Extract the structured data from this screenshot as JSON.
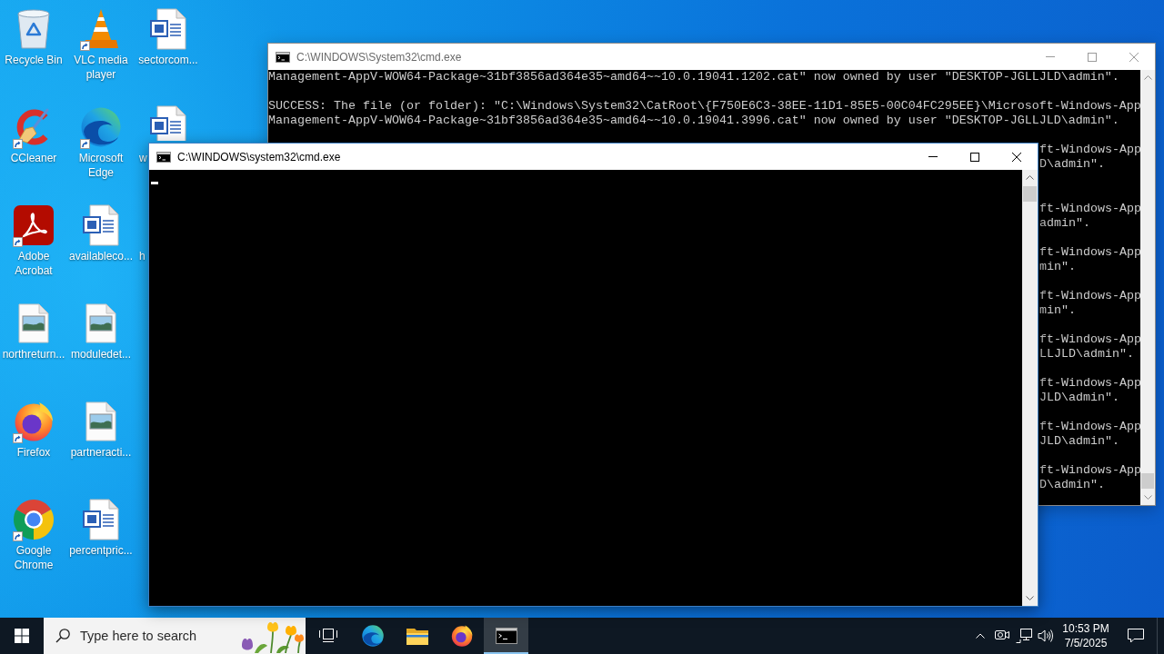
{
  "desktop_icons": [
    {
      "label": "Recycle Bin",
      "kind": "recycle-bin",
      "shortcut": false
    },
    {
      "label": "CCleaner",
      "kind": "ccleaner",
      "shortcut": true
    },
    {
      "label": "Adobe Acrobat",
      "kind": "acrobat",
      "shortcut": true
    },
    {
      "label": "northreturn...",
      "kind": "image-file",
      "shortcut": false
    },
    {
      "label": "Firefox",
      "kind": "firefox",
      "shortcut": true
    },
    {
      "label": "Google Chrome",
      "kind": "chrome",
      "shortcut": true
    },
    {
      "label": "VLC media player",
      "kind": "vlc",
      "shortcut": true
    },
    {
      "label": "Microsoft Edge",
      "kind": "edge",
      "shortcut": true
    },
    {
      "label": "availableco...",
      "kind": "word-file",
      "shortcut": false
    },
    {
      "label": "moduledet...",
      "kind": "image-file",
      "shortcut": false
    },
    {
      "label": "partneracti...",
      "kind": "image-file",
      "shortcut": false
    },
    {
      "label": "percentpric...",
      "kind": "word-file",
      "shortcut": false
    },
    {
      "label": "sectorcom...",
      "kind": "word-file",
      "shortcut": false
    }
  ],
  "covered_icons": [
    {
      "label": "w",
      "kind": "word-file"
    },
    {
      "label": "h",
      "kind": "covered"
    }
  ],
  "back_window": {
    "title": "C:\\WINDOWS\\System32\\cmd.exe",
    "active": false,
    "blocks": [
      [
        "Management-AppV-WOW64-Package~31bf3856ad364e35~amd64~~10.0.19041.1202.cat\" now owned by user \"DESKTOP-JGLLJLD\\admin\"."
      ],
      [
        "SUCCESS: The file (or folder): \"C:\\Windows\\System32\\CatRoot\\{F750E6C3-38EE-11D1-85E5-00C04FC295EE}\\Microsoft-Windows-App",
        "Management-AppV-WOW64-Package~31bf3856ad364e35~amd64~~10.0.19041.3996.cat\" now owned by user \"DESKTOP-JGLLJLD\\admin\"."
      ]
    ],
    "fragments": [
      [
        "ft-Windows-App",
        "D\\admin\"."
      ],
      [
        "ft-Windows-App",
        "admin\"."
      ],
      [
        "ft-Windows-App",
        "min\"."
      ],
      [
        "ft-Windows-App",
        "min\"."
      ],
      [
        "ft-Windows-App",
        "LLJLD\\admin\"."
      ],
      [
        "ft-Windows-App",
        "JLD\\admin\"."
      ],
      [
        "ft-Windows-App",
        "JLD\\admin\"."
      ],
      [
        "ft-Windows-App",
        "D\\admin\"."
      ]
    ]
  },
  "front_window": {
    "title": "C:\\WINDOWS\\system32\\cmd.exe",
    "active": true
  },
  "taskbar": {
    "search": {
      "placeholder": "Type here to search"
    },
    "apps": [
      {
        "kind": "task-view",
        "selected": false
      },
      {
        "kind": "edge",
        "selected": false
      },
      {
        "kind": "file-explorer",
        "selected": false
      },
      {
        "kind": "firefox",
        "selected": false
      },
      {
        "kind": "terminal",
        "selected": true
      }
    ],
    "clock": {
      "time": "10:53 PM",
      "date": "7/5/2025"
    }
  }
}
